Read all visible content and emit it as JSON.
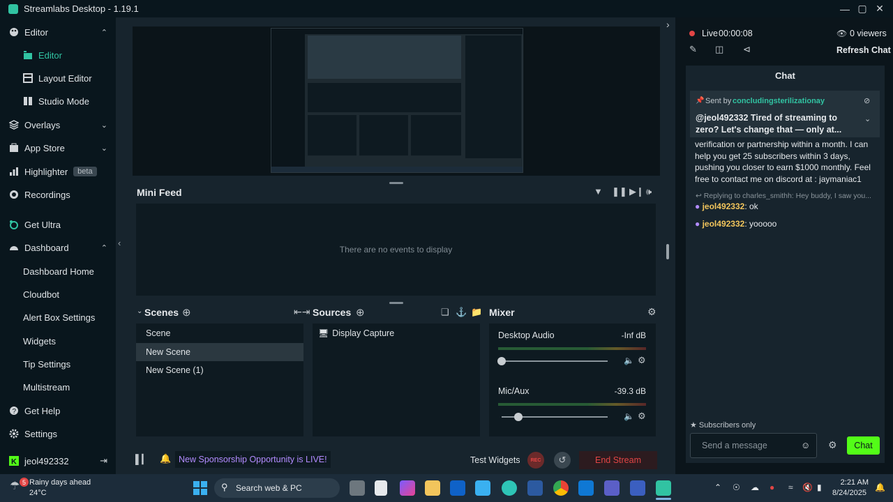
{
  "window": {
    "title": "Streamlabs Desktop - 1.19.1"
  },
  "colors": {
    "accent": "#31c3a2",
    "live": "#e24545",
    "chat_button": "#53fc18",
    "username": "#f2c55c",
    "sponsor": "#b28bff",
    "end_stream": "#e24545"
  },
  "sidebar": {
    "editor": "Editor",
    "editor_sub": "Editor",
    "layout_editor": "Layout Editor",
    "studio_mode": "Studio Mode",
    "overlays": "Overlays",
    "app_store": "App Store",
    "highlighter": "Highlighter",
    "highlighter_badge": "beta",
    "recordings": "Recordings",
    "get_ultra": "Get Ultra",
    "dashboard": "Dashboard",
    "dashboard_home": "Dashboard Home",
    "cloudbot": "Cloudbot",
    "alert_box": "Alert Box Settings",
    "widgets": "Widgets",
    "tip_settings": "Tip Settings",
    "multistream": "Multistream",
    "get_help": "Get Help",
    "settings": "Settings",
    "account": "jeol492332"
  },
  "mini_feed": {
    "title": "Mini Feed",
    "empty": "There are no events to display"
  },
  "scenes": {
    "title": "Scenes",
    "items": [
      "Scene",
      "New Scene",
      "New Scene (1)"
    ],
    "selected": "New Scene"
  },
  "sources": {
    "title": "Sources",
    "items": [
      "Display Capture"
    ]
  },
  "mixer": {
    "title": "Mixer",
    "channels": [
      {
        "name": "Desktop Audio",
        "db": "-Inf dB",
        "level": 0.0
      },
      {
        "name": "Mic/Aux",
        "db": "-39.3 dB",
        "level": 0.16
      }
    ]
  },
  "bottombar": {
    "sponsor": "New Sponsorship Opportunity is LIVE!",
    "test_widgets": "Test Widgets",
    "rec": "REC",
    "end_stream": "End Stream"
  },
  "stream": {
    "live_label": "Live",
    "time": "00:00:08",
    "viewers": "0 viewers",
    "refresh": "Refresh Chat"
  },
  "chat": {
    "title": "Chat",
    "pinned": {
      "sent_by_label": "Sent by",
      "sender": "concludingsterilizationay",
      "text": "@jeol492332 Tired of streaming to zero? Let's change that — only at..."
    },
    "overflow_lines": [
      "verification or partnership within a month. I can",
      "help you get 25 subscribers within 3 days,",
      "pushing you closer to earn $1000 monthly. Feel",
      "free to contact me on discord at : jaymaniac1"
    ],
    "reply_hint": "Replying to charles_smithh: Hey buddy, I saw you...",
    "messages": [
      {
        "user": "jeol492332",
        "text": ": ok"
      },
      {
        "user": "jeol492332",
        "text": ": yooooo"
      }
    ],
    "mode": "Subscribers only",
    "placeholder": "Send a message",
    "send": "Chat"
  },
  "taskbar": {
    "weather_title": "Rainy days ahead",
    "weather_temp": "24°C",
    "weather_badge": "5",
    "search": "Search web & PC",
    "time": "2:21 AM",
    "date": "8/24/2025"
  }
}
